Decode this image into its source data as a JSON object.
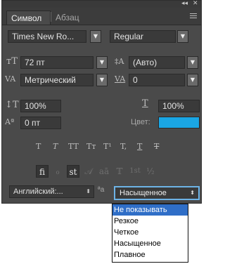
{
  "tabs": {
    "active": "Символ",
    "inactive": "Абзац"
  },
  "window_controls": {
    "collapse": "◂◂",
    "close": "✕"
  },
  "font": {
    "family": "Times New Ro...",
    "style": "Regular"
  },
  "size": {
    "value": "72 пт"
  },
  "leading": {
    "value": "(Авто)"
  },
  "kerning": {
    "value": "Метрический"
  },
  "tracking": {
    "value": "0"
  },
  "vertical_scale": {
    "value": "100%"
  },
  "horizontal_scale": {
    "value": "100%"
  },
  "baseline_shift": {
    "value": "0 пт"
  },
  "color": {
    "label": "Цвет:",
    "swatch": "#1aa6e4"
  },
  "type_styles": [
    "T",
    "T",
    "TT",
    "Tт",
    "T¹",
    "T,",
    "T",
    "T"
  ],
  "ligatures": [
    "fi",
    "ℴ",
    "st",
    "𝒜",
    "aā",
    "𝕋",
    "1st",
    "½"
  ],
  "language": {
    "value": "Английский:..."
  },
  "antialias": {
    "icon": "ªa",
    "value": "Насыщенное"
  },
  "antialias_options": [
    "Не показывать",
    "Резкое",
    "Четкое",
    "Насыщенное",
    "Плавное"
  ],
  "accent_color": "#2f6ec7"
}
